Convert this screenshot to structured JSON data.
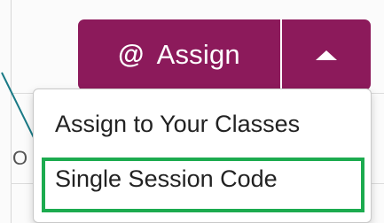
{
  "assign_button": {
    "icon": "at-icon",
    "icon_glyph": "@",
    "label": "Assign"
  },
  "toggle_button": {
    "icon": "caret-up-icon"
  },
  "menu": {
    "items": [
      {
        "label": "Assign to Your Classes"
      },
      {
        "label": "Single Session Code"
      }
    ]
  },
  "background": {
    "fragment_text": "O"
  },
  "colors": {
    "button": "#8c1a5b",
    "highlight": "#1cab4f",
    "pointer_line": "#1a7a86"
  }
}
